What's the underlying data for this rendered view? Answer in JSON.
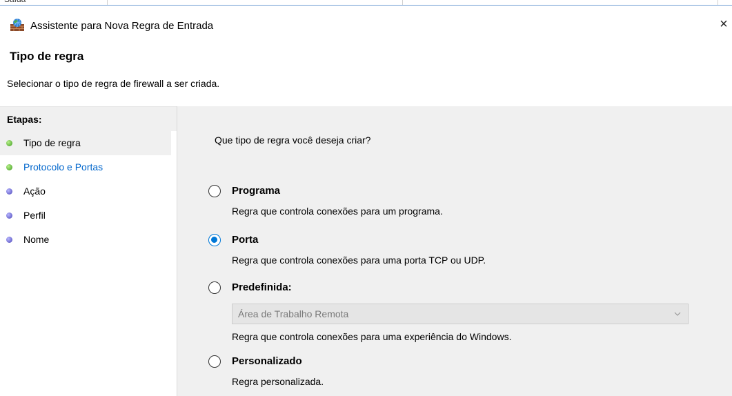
{
  "window": {
    "title": "Assistente para Nova Regra de Entrada",
    "close_glyph": "×",
    "icon": "firewall-icon"
  },
  "header": {
    "title": "Tipo de regra",
    "subtitle": "Selecionar o tipo de regra de firewall a ser criada."
  },
  "steps": {
    "header": "Etapas:",
    "items": [
      {
        "label": "Tipo de regra",
        "dot": "green",
        "state": "current"
      },
      {
        "label": "Protocolo e Portas",
        "dot": "green",
        "state": "link"
      },
      {
        "label": "Ação",
        "dot": "blue",
        "state": "pending"
      },
      {
        "label": "Perfil",
        "dot": "blue",
        "state": "pending"
      },
      {
        "label": "Nome",
        "dot": "blue",
        "state": "pending"
      }
    ]
  },
  "main": {
    "question": "Que tipo de regra você deseja criar?",
    "options": [
      {
        "label": "Programa",
        "description": "Regra que controla conexões para um programa.",
        "checked": false
      },
      {
        "label": "Porta",
        "description": "Regra que controla conexões para uma porta TCP ou UDP.",
        "checked": true
      },
      {
        "label": "Predefinida:",
        "description": "Regra que controla conexões para uma experiência do Windows.",
        "checked": false,
        "select": {
          "value": "Área de Trabalho Remota",
          "disabled": true
        }
      },
      {
        "label": "Personalizado",
        "description": "Regra personalizada.",
        "checked": false
      }
    ]
  },
  "colors": {
    "accent": "#0078d7",
    "link": "#0066cc",
    "panel": "#f0f0f0",
    "dot_green": "#3c9a1e",
    "dot_blue": "#4b46b8"
  }
}
